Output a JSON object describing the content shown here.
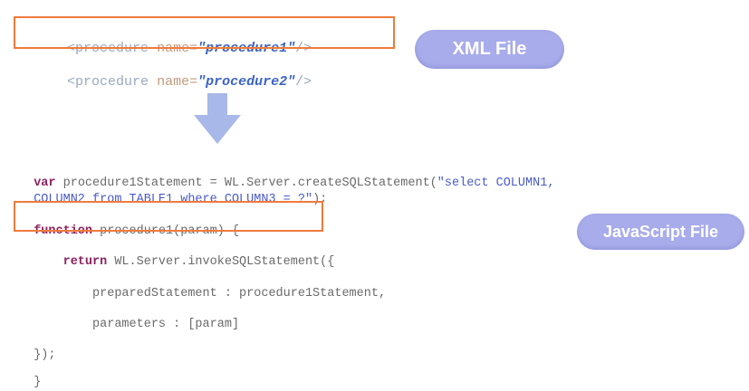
{
  "xml": {
    "lines": [
      {
        "indent": "    ",
        "open": "<procedure ",
        "attr": "name=",
        "value": "\"procedure1\"",
        "close": "/>"
      },
      {
        "indent": "    ",
        "open": "<procedure ",
        "attr": "name=",
        "value": "\"procedure2\"",
        "close": "/>"
      }
    ],
    "label": "XML File"
  },
  "javascript": {
    "label": "JavaScript File",
    "line1": {
      "kw": "var",
      "text": " procedure1Statement = WL.Server.createSQLStatement(",
      "str": "\"select COLUMN1,"
    },
    "line2": {
      "str": "COLUMN2 from TABLE1 where COLUMN3 = ?\"",
      "text": ");"
    },
    "line3": {
      "kw": "function",
      "text": " procedure1(param) {"
    },
    "line4": {
      "indent": "    ",
      "kw": "return",
      "text": " WL.Server.invokeSQLStatement({"
    },
    "line5": {
      "text": "        preparedStatement : procedure1Statement,"
    },
    "line6": {
      "text": "        parameters : [param]"
    },
    "line7": {
      "text": "});"
    },
    "line8": {
      "text": "}"
    }
  },
  "colors": {
    "highlight": "#ef7a3c",
    "arrow": "#a8b8e8",
    "bubble": "#a8acea",
    "keyword": "#8e2260",
    "string": "#4b5bc8"
  }
}
